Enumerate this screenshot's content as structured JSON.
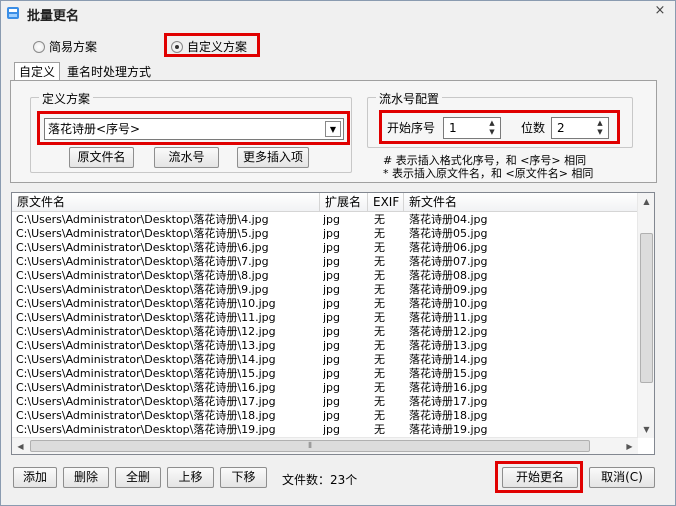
{
  "window": {
    "title": "批量更名",
    "close_glyph": "×"
  },
  "scheme": {
    "simple_label": "简易方案",
    "custom_label": "自定义方案",
    "selected": "custom"
  },
  "tabs": [
    {
      "label": "自定义",
      "active": true
    },
    {
      "label": "重名时处理方式",
      "active": false
    }
  ],
  "definition": {
    "group_title": "定义方案",
    "pattern_value": "落花诗册<序号>",
    "insert_buttons": [
      "原文件名",
      "流水号",
      "更多插入项"
    ]
  },
  "serial": {
    "group_title": "流水号配置",
    "start_label": "开始序号",
    "start_value": "1",
    "digits_label": "位数",
    "digits_value": "2",
    "hint1": "# 表示插入格式化序号，和 <序号> 相同",
    "hint2": "* 表示插入原文件名，和 <原文件名> 相同"
  },
  "list": {
    "columns": [
      "原文件名",
      "扩展名",
      "EXIF",
      "新文件名"
    ],
    "rows": [
      {
        "orig": "C:\\Users\\Administrator\\Desktop\\落花诗册\\4.jpg",
        "ext": "jpg",
        "exif": "无",
        "new": "落花诗册04.jpg"
      },
      {
        "orig": "C:\\Users\\Administrator\\Desktop\\落花诗册\\5.jpg",
        "ext": "jpg",
        "exif": "无",
        "new": "落花诗册05.jpg"
      },
      {
        "orig": "C:\\Users\\Administrator\\Desktop\\落花诗册\\6.jpg",
        "ext": "jpg",
        "exif": "无",
        "new": "落花诗册06.jpg"
      },
      {
        "orig": "C:\\Users\\Administrator\\Desktop\\落花诗册\\7.jpg",
        "ext": "jpg",
        "exif": "无",
        "new": "落花诗册07.jpg"
      },
      {
        "orig": "C:\\Users\\Administrator\\Desktop\\落花诗册\\8.jpg",
        "ext": "jpg",
        "exif": "无",
        "new": "落花诗册08.jpg"
      },
      {
        "orig": "C:\\Users\\Administrator\\Desktop\\落花诗册\\9.jpg",
        "ext": "jpg",
        "exif": "无",
        "new": "落花诗册09.jpg"
      },
      {
        "orig": "C:\\Users\\Administrator\\Desktop\\落花诗册\\10.jpg",
        "ext": "jpg",
        "exif": "无",
        "new": "落花诗册10.jpg"
      },
      {
        "orig": "C:\\Users\\Administrator\\Desktop\\落花诗册\\11.jpg",
        "ext": "jpg",
        "exif": "无",
        "new": "落花诗册11.jpg"
      },
      {
        "orig": "C:\\Users\\Administrator\\Desktop\\落花诗册\\12.jpg",
        "ext": "jpg",
        "exif": "无",
        "new": "落花诗册12.jpg"
      },
      {
        "orig": "C:\\Users\\Administrator\\Desktop\\落花诗册\\13.jpg",
        "ext": "jpg",
        "exif": "无",
        "new": "落花诗册13.jpg"
      },
      {
        "orig": "C:\\Users\\Administrator\\Desktop\\落花诗册\\14.jpg",
        "ext": "jpg",
        "exif": "无",
        "new": "落花诗册14.jpg"
      },
      {
        "orig": "C:\\Users\\Administrator\\Desktop\\落花诗册\\15.jpg",
        "ext": "jpg",
        "exif": "无",
        "new": "落花诗册15.jpg"
      },
      {
        "orig": "C:\\Users\\Administrator\\Desktop\\落花诗册\\16.jpg",
        "ext": "jpg",
        "exif": "无",
        "new": "落花诗册16.jpg"
      },
      {
        "orig": "C:\\Users\\Administrator\\Desktop\\落花诗册\\17.jpg",
        "ext": "jpg",
        "exif": "无",
        "new": "落花诗册17.jpg"
      },
      {
        "orig": "C:\\Users\\Administrator\\Desktop\\落花诗册\\18.jpg",
        "ext": "jpg",
        "exif": "无",
        "new": "落花诗册18.jpg"
      },
      {
        "orig": "C:\\Users\\Administrator\\Desktop\\落花诗册\\19.jpg",
        "ext": "jpg",
        "exif": "无",
        "new": "落花诗册19.jpg"
      }
    ]
  },
  "footer": {
    "add": "添加",
    "delete": "删除",
    "delete_all": "全删",
    "move_up": "上移",
    "move_down": "下移",
    "file_count": "文件数：23个",
    "start_rename": "开始更名",
    "cancel": "取消(C)"
  },
  "colors": {
    "highlight": "#e00000",
    "list_border": "#828790"
  }
}
